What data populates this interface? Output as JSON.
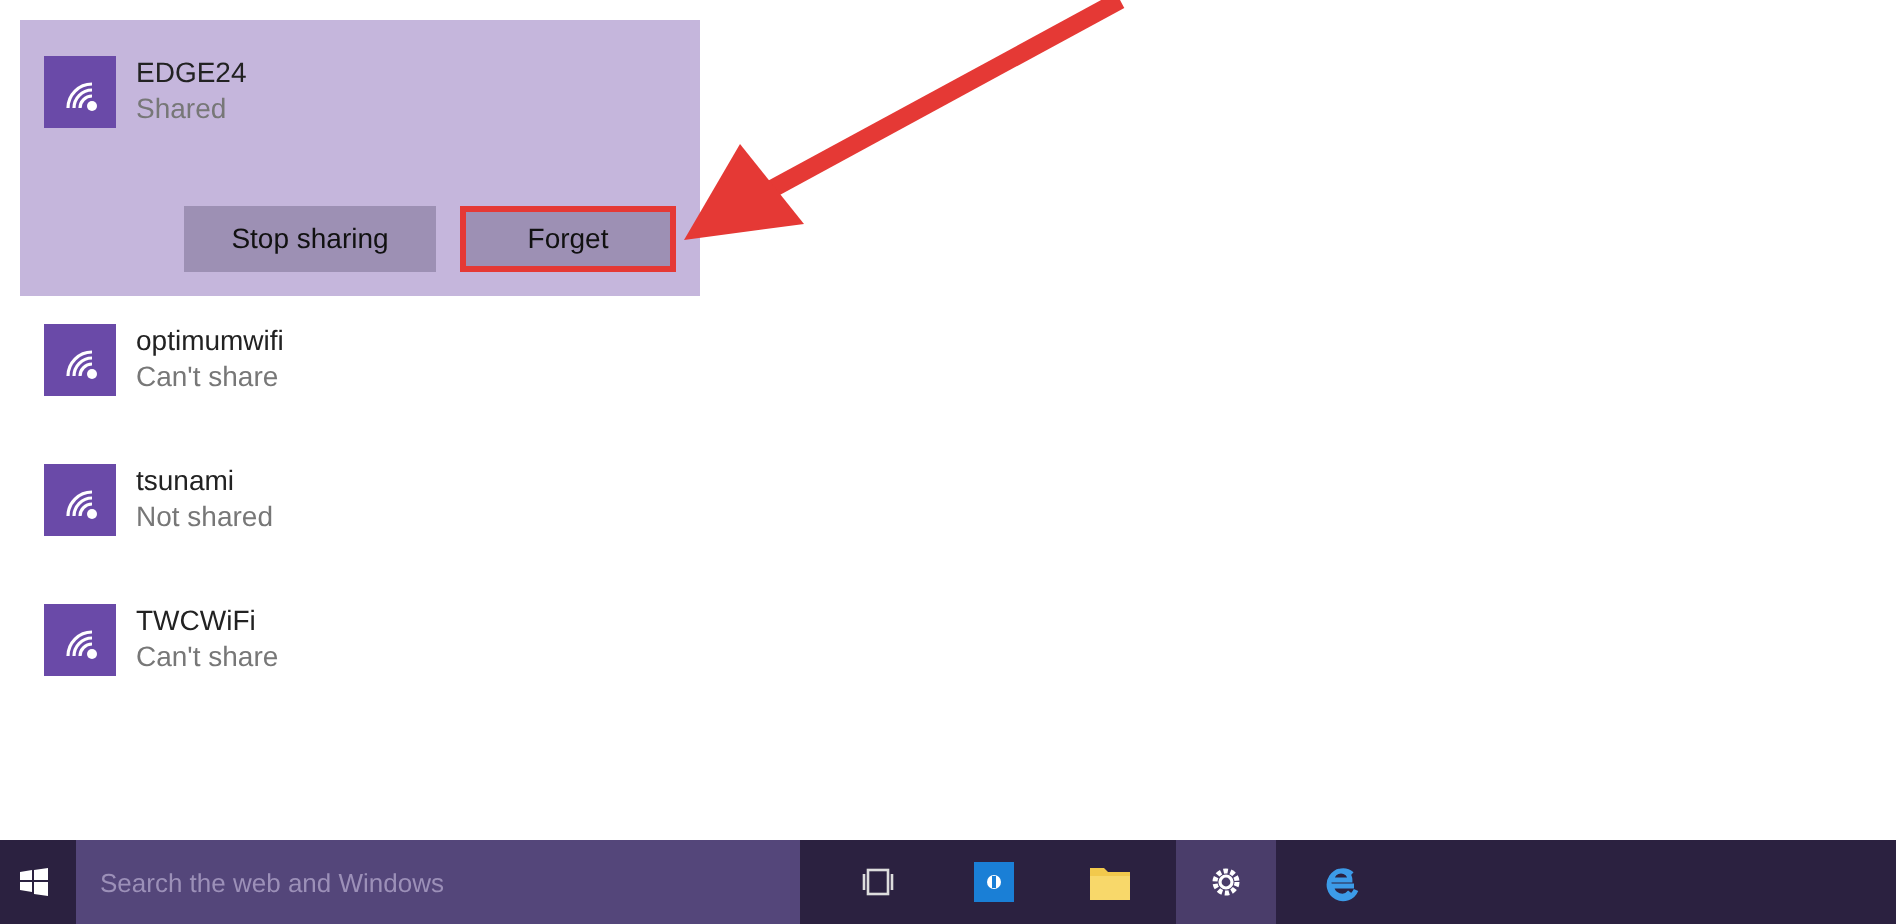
{
  "networks": [
    {
      "name": "EDGE24",
      "status": "Shared",
      "selected": true,
      "actions": [
        {
          "label": "Stop sharing",
          "highlighted": false
        },
        {
          "label": "Forget",
          "highlighted": true
        }
      ]
    },
    {
      "name": "optimumwifi",
      "status": "Can't share",
      "selected": false
    },
    {
      "name": "tsunami",
      "status": "Not shared",
      "selected": false
    },
    {
      "name": "TWCWiFi",
      "status": "Can't share",
      "selected": false
    }
  ],
  "taskbar": {
    "search": {
      "placeholder": "Search the web and Windows"
    },
    "apps": [
      {
        "kind": "taskview",
        "selected": false
      },
      {
        "kind": "store",
        "selected": false
      },
      {
        "kind": "folder",
        "selected": false
      },
      {
        "kind": "settings",
        "selected": true
      },
      {
        "kind": "browser",
        "selected": false
      }
    ]
  }
}
